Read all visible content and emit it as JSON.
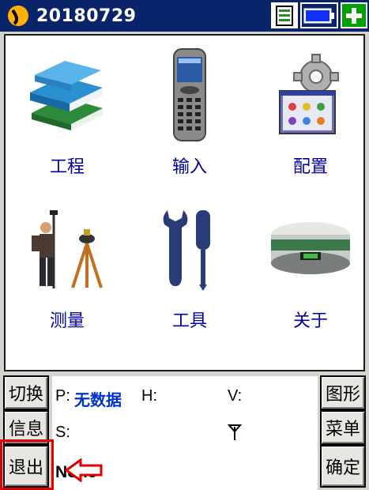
{
  "titlebar": {
    "title": "20180729",
    "icons": [
      "app-logo-icon",
      "document-icon",
      "battery-icon",
      "plus-icon"
    ]
  },
  "menu": {
    "items": [
      {
        "label": "工程",
        "icon": "books-icon"
      },
      {
        "label": "输入",
        "icon": "handheld-device-icon"
      },
      {
        "label": "配置",
        "icon": "gear-settings-icon"
      },
      {
        "label": "测量",
        "icon": "surveyor-tripod-icon"
      },
      {
        "label": "工具",
        "icon": "wrench-screwdriver-icon"
      },
      {
        "label": "关于",
        "icon": "gnss-receiver-icon"
      }
    ]
  },
  "left_buttons": [
    "切换",
    "信息",
    "退出"
  ],
  "right_buttons": [
    "图形",
    "菜单",
    "确定"
  ],
  "status": {
    "p_label": "P:",
    "p_value": "无数据",
    "h_label": "H:",
    "v_label": "V:",
    "s_label": "S:",
    "solution": "None"
  },
  "colors": {
    "titlebar": "#0a246a",
    "label_text": "#0000a0",
    "highlight": "#e00000",
    "p_value": "#0033cc"
  }
}
